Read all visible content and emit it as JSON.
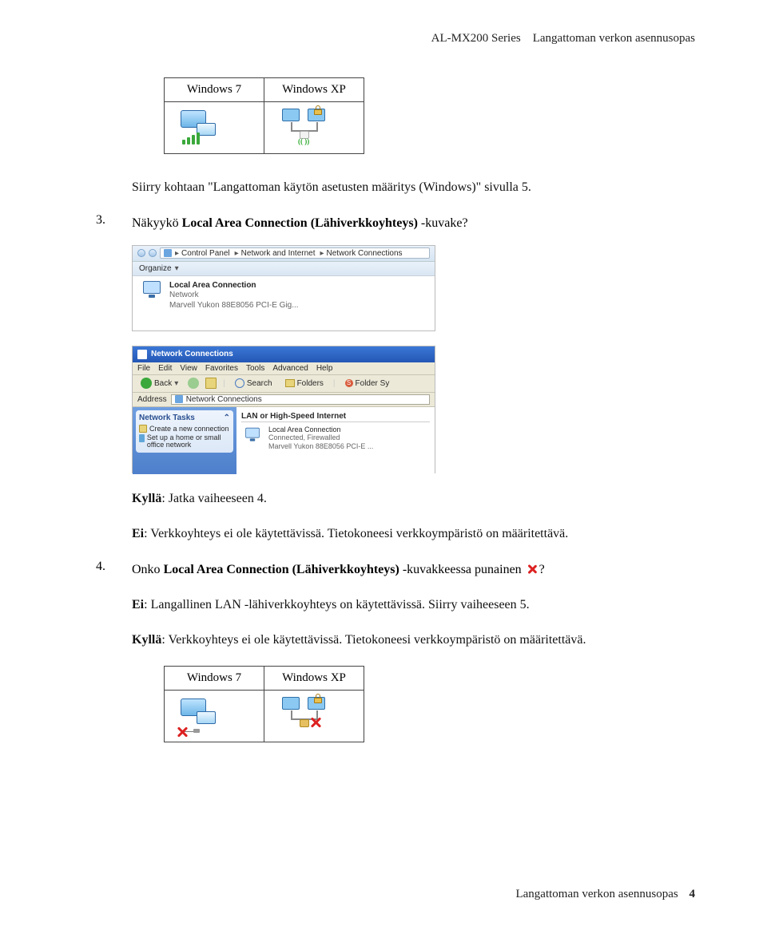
{
  "header": {
    "series": "AL-MX200 Series",
    "doc_title": "Langattoman verkon asennusopas"
  },
  "os_table_top": {
    "col1": "Windows 7",
    "col2": "Windows XP"
  },
  "text": {
    "jump_line": "Siirry kohtaan \"Langattoman käytön asetusten määritys (Windows)\" sivulla 5.",
    "step3_num": "3.",
    "step3_prefix": "Näkyykö ",
    "step3_bold": "Local Area Connection (Lähiverkkoyhteys)",
    "step3_suffix": " -kuvake?",
    "kylla_label": "Kyllä",
    "kylla_text": ": Jatka vaiheeseen 4.",
    "ei_label": "Ei",
    "ei_text": ": Verkkoyhteys ei ole käytettävissä. Tietokoneesi verkkoympäristö on määritettävä.",
    "step4_num": "4.",
    "step4_prefix": "Onko ",
    "step4_bold": "Local Area Connection (Lähiverkkoyhteys)",
    "step4_mid": " -kuvakkeessa punainen ",
    "step4_suffix": "?",
    "ei4_label": "Ei",
    "ei4_text": ": Langallinen LAN -lähiverkkoyhteys on käytettävissä. Siirry vaiheeseen 5.",
    "kylla4_label": "Kyllä",
    "kylla4_text": ": Verkkoyhteys ei ole käytettävissä. Tietokoneesi verkkoympäristö on määritettävä."
  },
  "shot_top": {
    "crumb1": "Control Panel",
    "crumb2": "Network and Internet",
    "crumb3": "Network Connections",
    "organize": "Organize",
    "conn_name": "Local Area Connection",
    "conn_sub1": "Network",
    "conn_sub2": "Marvell Yukon 88E8056 PCI-E Gig..."
  },
  "shot_xp": {
    "title": "Network Connections",
    "menu": [
      "File",
      "Edit",
      "View",
      "Favorites",
      "Tools",
      "Advanced",
      "Help"
    ],
    "toolbar": {
      "back": "Back",
      "search": "Search",
      "folders": "Folders",
      "foldersy": "Folder Sy"
    },
    "addr_label": "Address",
    "addr_value": "Network Connections",
    "side_hdr": "Network Tasks",
    "side_item1": "Create a new connection",
    "side_item2": "Set up a home or small office network",
    "section": "LAN or High-Speed Internet",
    "conn_name": "Local Area Connection",
    "conn_sub1": "Connected, Firewalled",
    "conn_sub2": "Marvell Yukon 88E8056 PCI-E ..."
  },
  "os_table_bottom": {
    "col1": "Windows 7",
    "col2": "Windows XP"
  },
  "footer": {
    "text": "Langattoman verkon asennusopas",
    "page": "4"
  }
}
